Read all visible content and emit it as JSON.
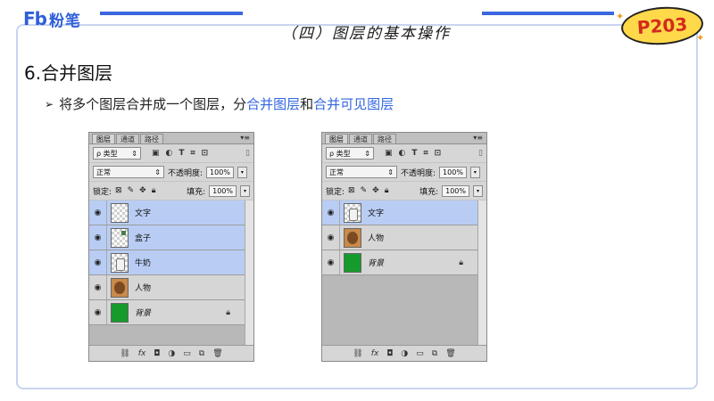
{
  "header": {
    "logo_mark": "Fb",
    "logo_name": "粉笔",
    "section_title": "（四）图层的基本操作",
    "page_badge": "P203"
  },
  "heading": "6.合并图层",
  "bullet": {
    "prefix": "将多个图层合并成一个图层，分",
    "highlight1": "合并图层",
    "middle": "和",
    "highlight2": "合并可见图层"
  },
  "colors": {
    "accent": "#3b67e0",
    "highlight_text": "#3366e0",
    "badge_bg": "#ffd94a",
    "badge_text": "#d42a1c",
    "selected_layer": "#b9cdf4",
    "background_layer": "#179a2c"
  },
  "panel_left": {
    "tabs": [
      "图层",
      "通道",
      "路径"
    ],
    "filter_label": "ρ 类型",
    "blend_mode": "正常",
    "opacity_label": "不透明度:",
    "opacity_value": "100%",
    "lock_label": "锁定:",
    "fill_label": "填充:",
    "fill_value": "100%",
    "layers": [
      {
        "name": "文字",
        "thumb": "transparent",
        "selected": true
      },
      {
        "name": "盒子",
        "thumb": "box",
        "selected": true
      },
      {
        "name": "牛奶",
        "thumb": "milk",
        "selected": true
      },
      {
        "name": "人物",
        "thumb": "person",
        "selected": false
      },
      {
        "name": "背景",
        "thumb": "green",
        "selected": false,
        "locked": true
      }
    ]
  },
  "panel_right": {
    "tabs": [
      "图层",
      "通道",
      "路径"
    ],
    "filter_label": "ρ 类型",
    "blend_mode": "正常",
    "opacity_label": "不透明度:",
    "opacity_value": "100%",
    "lock_label": "锁定:",
    "fill_label": "填充:",
    "fill_value": "100%",
    "layers": [
      {
        "name": "文字",
        "thumb": "milk",
        "selected": true
      },
      {
        "name": "人物",
        "thumb": "person",
        "selected": false
      },
      {
        "name": "背景",
        "thumb": "green",
        "selected": false,
        "locked": true
      }
    ]
  },
  "icons": {
    "eye": "eye-icon",
    "lock": "lock-icon",
    "footer": [
      "link-icon",
      "fx-icon",
      "mask-icon",
      "adjustment-icon",
      "folder-icon",
      "new-layer-icon",
      "trash-icon"
    ]
  }
}
